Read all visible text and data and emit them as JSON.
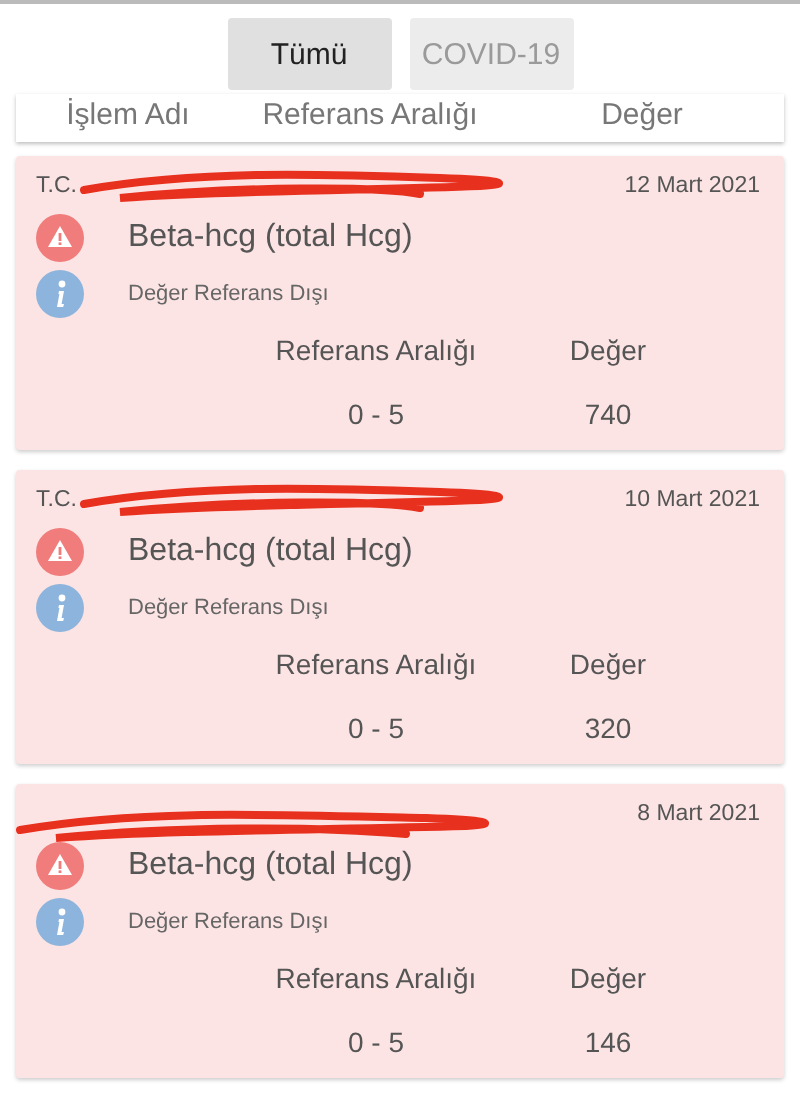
{
  "filter_tabs": [
    {
      "label": "Tümü",
      "selected": true
    },
    {
      "label": "COVID-19",
      "selected": false
    }
  ],
  "columns": [
    "İşlem Adı",
    "Referans Aralığı",
    "Değer"
  ],
  "results": [
    {
      "institution": "T.C.",
      "redacted": true,
      "date": "12 Mart 2021",
      "test": "Beta-hcg (total Hcg)",
      "status": "Değer Referans Dışı",
      "range_label": "Referans Aralığı",
      "value_label": "Değer",
      "range": "0 - 5",
      "value": "740"
    },
    {
      "institution": "T.C.",
      "redacted": true,
      "date": "10 Mart 2021",
      "test": "Beta-hcg (total Hcg)",
      "status": "Değer Referans Dışı",
      "range_label": "Referans Aralığı",
      "value_label": "Değer",
      "range": "0 - 5",
      "value": "320"
    },
    {
      "redacted": true,
      "date": "8 Mart 2021",
      "test": "Beta-hcg (total Hcg)",
      "status": "Değer Referans Dışı",
      "range_label": "Referans Aralığı",
      "value_label": "Değer",
      "range": "0 - 5",
      "value": "146"
    }
  ]
}
